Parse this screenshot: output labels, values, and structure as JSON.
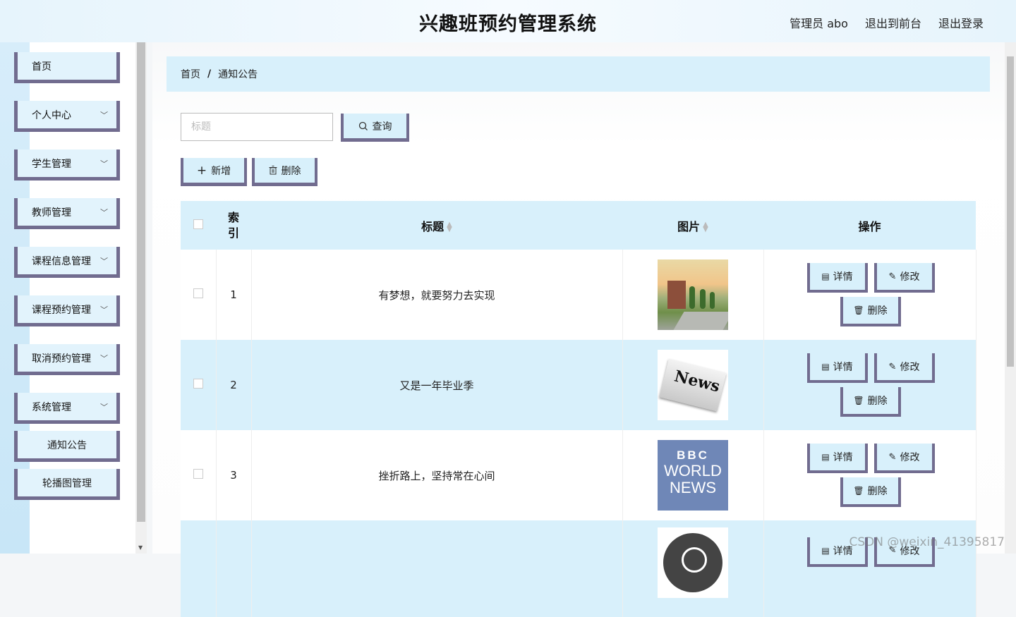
{
  "header": {
    "title": "兴趣班预约管理系统",
    "links": [
      "管理员 abo",
      "退出到前台",
      "退出登录"
    ]
  },
  "sidebar": {
    "items": [
      {
        "label": "首页",
        "has_children": false
      },
      {
        "label": "个人中心",
        "has_children": true
      },
      {
        "label": "学生管理",
        "has_children": true
      },
      {
        "label": "教师管理",
        "has_children": true
      },
      {
        "label": "课程信息管理",
        "has_children": true
      },
      {
        "label": "课程预约管理",
        "has_children": true
      },
      {
        "label": "取消预约管理",
        "has_children": true
      },
      {
        "label": "系统管理",
        "has_children": true
      }
    ],
    "subitems": [
      "通知公告",
      "轮播图管理"
    ]
  },
  "breadcrumb": {
    "home": "首页",
    "separator": "/",
    "current": "通知公告"
  },
  "search": {
    "placeholder": "标题",
    "button_label": "查询"
  },
  "toolbar": {
    "add_label": "新增",
    "delete_label": "删除"
  },
  "table": {
    "headers": {
      "index": "索引",
      "title": "标题",
      "image": "图片",
      "actions": "操作"
    },
    "rows": [
      {
        "index": "1",
        "title": "有梦想，就要努力去实现",
        "image": "campus-photo"
      },
      {
        "index": "2",
        "title": "又是一年毕业季",
        "image": "news-newspaper"
      },
      {
        "index": "3",
        "title": "挫折路上，坚持常在心间",
        "image": "bbc-world-news"
      },
      {
        "index": "",
        "title": "",
        "image": "globe-icon"
      }
    ],
    "actions": {
      "detail": "详情",
      "edit": "修改",
      "delete": "删除"
    },
    "image_texts": {
      "news": "News",
      "bbc_top": "BBC",
      "bbc_mid": "WORLD",
      "bbc_bot": "NEWS"
    }
  },
  "watermark": "CSDN @weixin_41395817",
  "colors": {
    "accent_border": "#716c8f",
    "light_blue": "#d8f0fb",
    "bbc_blue": "#6f87b7"
  }
}
